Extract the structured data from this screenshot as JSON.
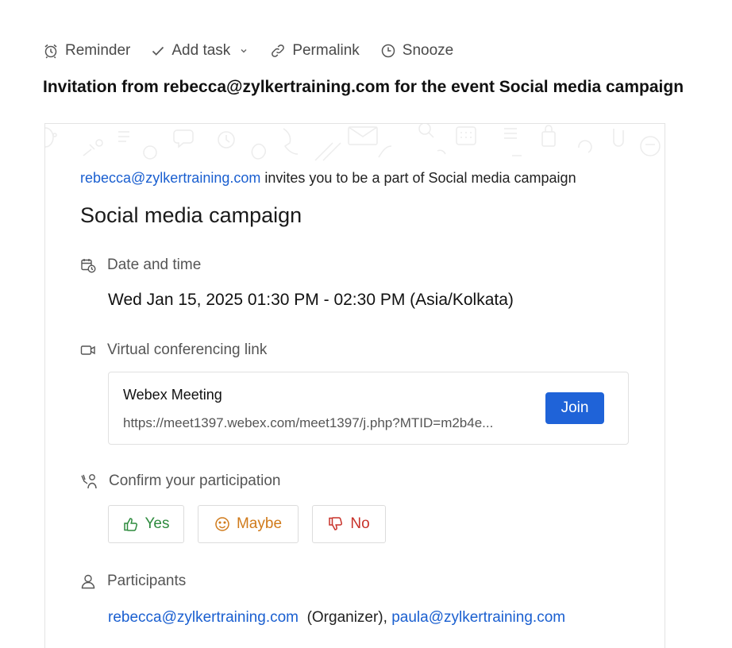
{
  "toolbar": {
    "reminder_label": "Reminder",
    "add_task_label": "Add task",
    "permalink_label": "Permalink",
    "snooze_label": "Snooze"
  },
  "subject": "Invitation from rebecca@zylkertraining.com for the event Social media campaign",
  "invite": {
    "sender": "rebecca@zylkertraining.com",
    "text": " invites you to be a part of Social media campaign",
    "event_title": "Social media campaign"
  },
  "date_section": {
    "label": "Date and time",
    "value": "Wed Jan 15, 2025 01:30 PM - 02:30 PM (Asia/Kolkata)"
  },
  "conference": {
    "label": "Virtual conferencing link",
    "name": "Webex Meeting",
    "url": "https://meet1397.webex.com/meet1397/j.php?MTID=m2b4e...",
    "join_label": "Join"
  },
  "rsvp": {
    "label": "Confirm your participation",
    "yes": "Yes",
    "maybe": "Maybe",
    "no": "No"
  },
  "participants": {
    "label": "Participants",
    "organizer": "rebecca@zylkertraining.com",
    "organizer_tag": "(Organizer),",
    "other": "paula@zylkertraining.com"
  },
  "colors": {
    "link": "#1a5fd0",
    "join_button": "#1f63d8",
    "yes": "#2e8b3e",
    "maybe": "#d07a1a",
    "no": "#c8322a"
  }
}
